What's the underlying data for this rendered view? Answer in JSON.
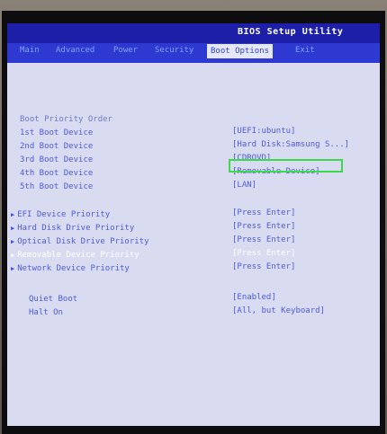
{
  "window": {
    "title": "BIOS Setup Utility"
  },
  "menu": {
    "tabs": [
      {
        "label": "Main"
      },
      {
        "label": "Advanced"
      },
      {
        "label": "Power"
      },
      {
        "label": "Security"
      },
      {
        "label": "Boot Options"
      },
      {
        "label": "Exit"
      }
    ],
    "active": "Boot Options"
  },
  "boot": {
    "heading": "Boot Priority Order",
    "devices": [
      {
        "label": "1st Boot Device",
        "value": "[UEFI:ubuntu]"
      },
      {
        "label": "2nd Boot Device",
        "value": "[Hard Disk:Samsung S...]"
      },
      {
        "label": "3rd Boot Device",
        "value": "[CDROVD]"
      },
      {
        "label": "4th Boot Device",
        "value": "[Removable Device]"
      },
      {
        "label": "5th Boot Device",
        "value": "[LAN]"
      }
    ],
    "submenus": [
      {
        "label": "EFI Device Priority",
        "value": "[Press Enter]"
      },
      {
        "label": "Hard Disk Drive Priority",
        "value": "[Press Enter]"
      },
      {
        "label": "Optical Disk Drive Priority",
        "value": "[Press Enter]"
      },
      {
        "label": "Removable Device Priority",
        "value": "[Press Enter]"
      },
      {
        "label": "Network Device Priority",
        "value": "[Press Enter]"
      }
    ],
    "options": [
      {
        "label": "Quiet Boot",
        "value": "[Enabled]"
      },
      {
        "label": "Halt On",
        "value": "[All, but Keyboard]"
      }
    ]
  },
  "colors": {
    "title_bar": "#1d1fa8",
    "menu_bar": "#2d39d0",
    "screen_bg": "#d9dcf0",
    "text": "#4c5ae0",
    "highlight_box": "#3ed84a"
  }
}
